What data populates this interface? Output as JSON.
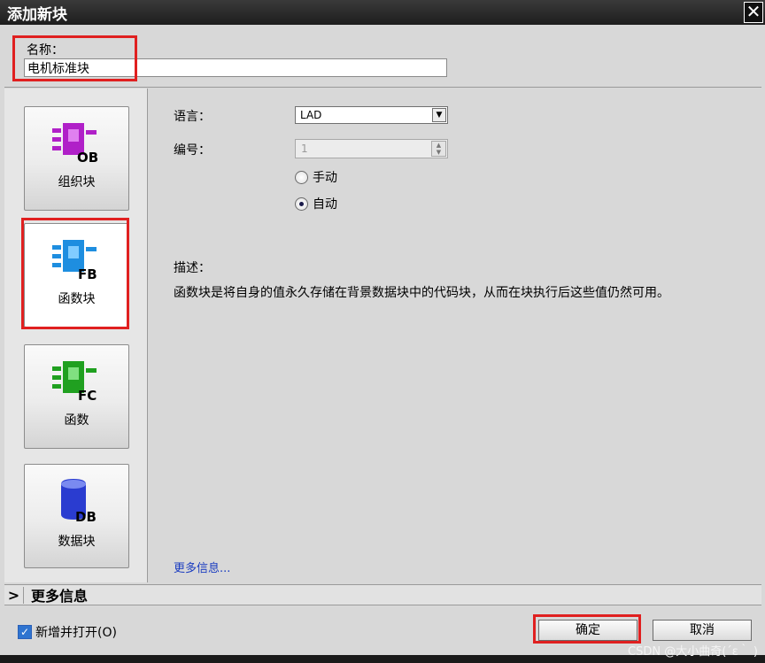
{
  "window": {
    "title": "添加新块",
    "close_glyph": "✕"
  },
  "name_field": {
    "label": "名称：",
    "value": "电机标准块"
  },
  "block_types": [
    {
      "icon": "ob-block-icon",
      "badge": "OB",
      "label": "组织块",
      "color": "#b020c8"
    },
    {
      "icon": "fb-block-icon",
      "badge": "FB",
      "label": "函数块",
      "color": "#1e8ee0"
    },
    {
      "icon": "fc-block-icon",
      "badge": "FC",
      "label": "函数",
      "color": "#20a020"
    },
    {
      "icon": "db-block-icon",
      "badge": "DB",
      "label": "数据块",
      "color": "#2a3cd0"
    }
  ],
  "properties": {
    "language_label": "语言：",
    "language_value": "LAD",
    "number_label": "编号：",
    "number_value": "1",
    "radio_manual": "手动",
    "radio_auto": "自动",
    "selected_radio": "自动"
  },
  "description": {
    "label": "描述：",
    "text": "函数块是将自身的值永久存储在背景数据块中的代码块，从而在块执行后这些值仍然可用。"
  },
  "more_info_link": "更多信息...",
  "expander": {
    "chevron": ">",
    "label": "更多信息"
  },
  "footer": {
    "open_checkbox_label": "新增并打开(O)",
    "checked": true,
    "ok_label": "确定",
    "cancel_label": "取消"
  },
  "watermark": "CSDN @大小曲奇(´ε｀ )",
  "colors": {
    "highlight": "#e02020",
    "link": "#1a3cc0",
    "titlebar": "#1e1e1e"
  }
}
